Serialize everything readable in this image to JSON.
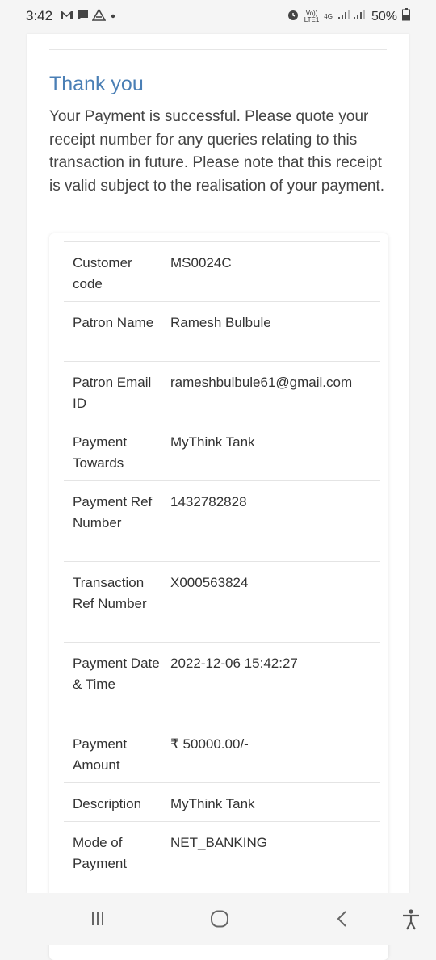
{
  "status_bar": {
    "time": "3:42",
    "network_label_top": "Vo))",
    "network_label_bottom": "LTE1",
    "network_type": "4G",
    "battery": "50%"
  },
  "receipt": {
    "title": "Thank you",
    "message": "Your Payment is successful. Please quote your receipt number for any queries relating to this transaction in future. Please note that this receipt is valid subject to the realisation of your payment.",
    "rows": [
      {
        "label": "Customer code",
        "value": "MS0024C"
      },
      {
        "label": "Patron Name",
        "value": "Ramesh Bulbule"
      },
      {
        "label": "Patron Email ID",
        "value": "rameshbulbule61@gmail.com"
      },
      {
        "label": "Payment Towards",
        "value": "MyThink Tank"
      },
      {
        "label": "Payment Ref Number",
        "value": "1432782828"
      },
      {
        "label": "Transaction Ref Number",
        "value": "X000563824"
      },
      {
        "label": "Payment Date & Time",
        "value": "2022-12-06 15:42:27"
      },
      {
        "label": "Payment Amount",
        "value": "₹ 50000.00/-"
      },
      {
        "label": "Description",
        "value": "MyThink Tank"
      },
      {
        "label": "Mode of Payment",
        "value": "NET_BANKING"
      }
    ]
  },
  "icons": {
    "gmail": "gmail-icon",
    "chat": "chat-icon",
    "alert": "drive-icon",
    "alarm": "alarm-icon",
    "signal": "signal-icon",
    "battery": "battery-icon",
    "recents": "recents-icon",
    "home": "home-icon",
    "back": "back-icon",
    "accessibility": "accessibility-icon"
  },
  "colors": {
    "title": "#4a7fb5",
    "background": "#f5f5f5"
  }
}
